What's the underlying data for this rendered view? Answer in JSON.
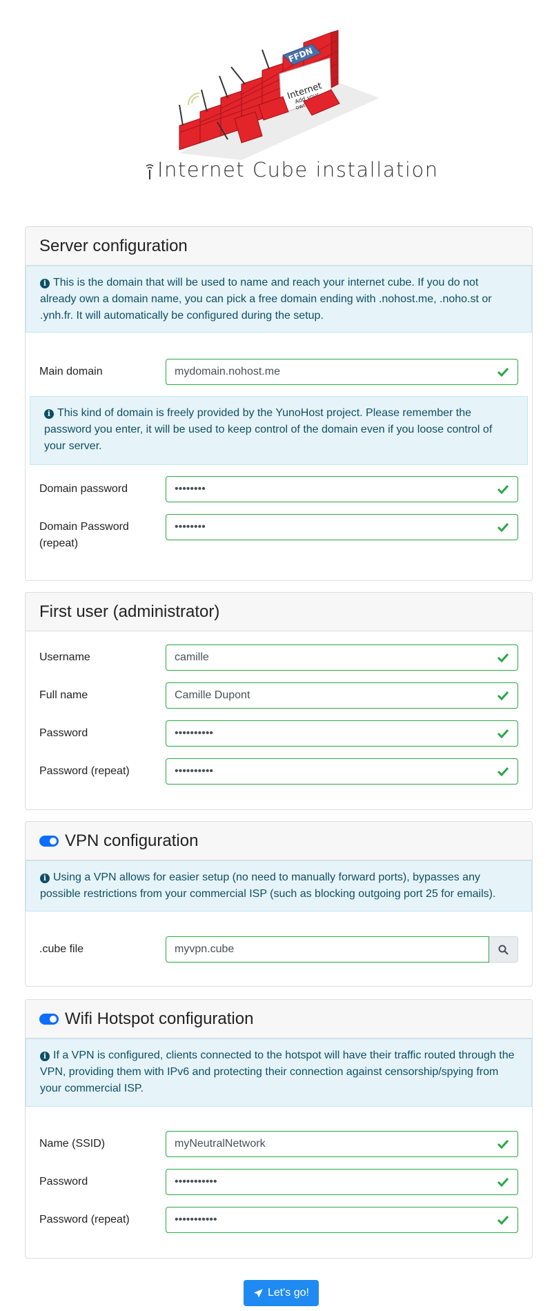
{
  "header": {
    "title": "Internet Cube installation",
    "logo": {
      "badge": "FFDN",
      "sign_title": "Internet",
      "sign_line1": "Add your",
      "sign_line2": "own Cube!"
    }
  },
  "server": {
    "title": "Server configuration",
    "info": "This is the domain that will be used to name and reach your internet cube. If you do not already own a domain name, you can pick a free domain ending with .nohost.me, .noho.st or .ynh.fr. It will automatically be configured during the setup.",
    "main_domain": {
      "label": "Main domain",
      "value": "mydomain.nohost.me"
    },
    "domain_info": "This kind of domain is freely provided by the YunoHost project. Please remember the password you enter, it will be used to keep control of the domain even if you loose control of your server.",
    "domain_password": {
      "label": "Domain password",
      "value": "••••••••"
    },
    "domain_password_repeat": {
      "label": "Domain Password (repeat)",
      "value": "••••••••"
    }
  },
  "user": {
    "title": "First user (administrator)",
    "username": {
      "label": "Username",
      "value": "camille"
    },
    "fullname": {
      "label": "Full name",
      "value": "Camille Dupont"
    },
    "password": {
      "label": "Password",
      "value": "••••••••••"
    },
    "password_repeat": {
      "label": "Password (repeat)",
      "value": "••••••••••"
    }
  },
  "vpn": {
    "title": "VPN configuration",
    "enabled": true,
    "info": "Using a VPN allows for easier setup (no need to manually forward ports), bypasses any possible restrictions from your commercial ISP (such as blocking outgoing port 25 for emails).",
    "cube_file": {
      "label": ".cube file",
      "value": "myvpn.cube"
    }
  },
  "wifi": {
    "title": "Wifi Hotspot configuration",
    "enabled": true,
    "info": "If a VPN is configured, clients connected to the hotspot will have their traffic routed through the VPN, providing them with IPv6 and protecting their connection against censorship/spying from your commercial ISP.",
    "ssid": {
      "label": "Name (SSID)",
      "value": "myNeutralNetwork"
    },
    "password": {
      "label": "Password",
      "value": "•••••••••••"
    },
    "password_repeat": {
      "label": "Password (repeat)",
      "value": "•••••••••••"
    }
  },
  "submit_label": "Let's go!",
  "colors": {
    "success": "#28a745",
    "primary": "#1e8af2",
    "info_bg": "#e6f4f9",
    "info_text": "#0e4f63",
    "logo_red": "#e3242b"
  }
}
